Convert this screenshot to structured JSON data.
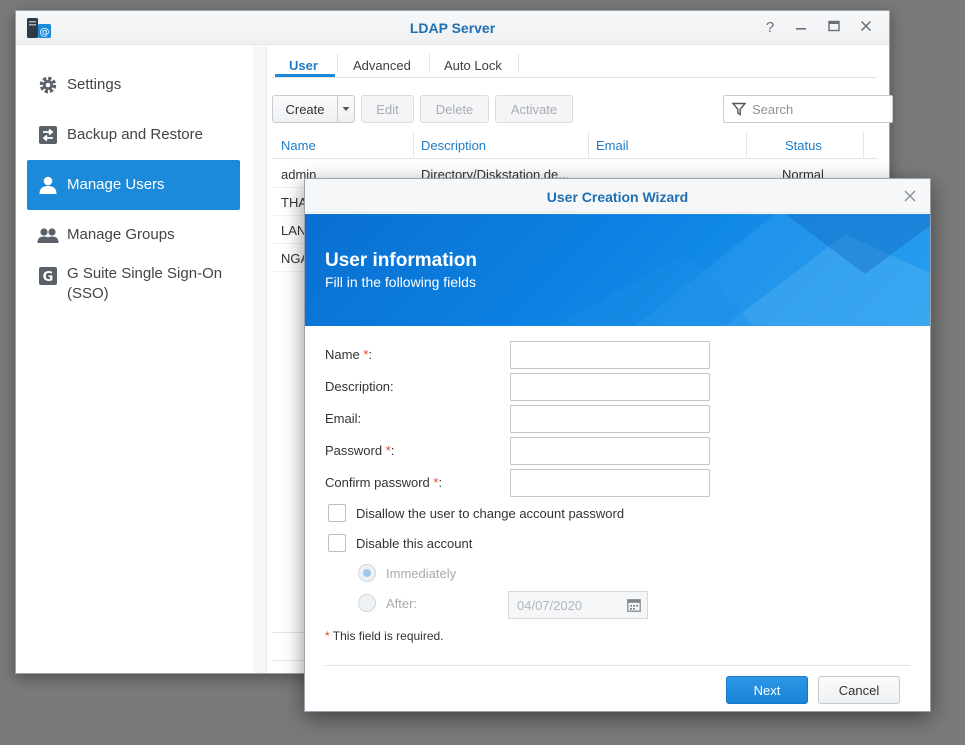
{
  "window": {
    "title": "LDAP Server"
  },
  "sidebar": {
    "items": [
      {
        "label": "Settings",
        "icon": "gear-icon"
      },
      {
        "label": "Backup and Restore",
        "icon": "backup-icon"
      },
      {
        "label": "Manage Users",
        "icon": "user-icon",
        "active": true
      },
      {
        "label": "Manage Groups",
        "icon": "group-icon"
      },
      {
        "label": "G Suite Single Sign-On (SSO)",
        "icon": "g-suite-icon"
      }
    ]
  },
  "tabs": [
    {
      "label": "User",
      "active": true
    },
    {
      "label": "Advanced"
    },
    {
      "label": "Auto Lock"
    }
  ],
  "toolbar": {
    "create": "Create",
    "edit": "Edit",
    "delete": "Delete",
    "activate": "Activate",
    "search_placeholder": "Search"
  },
  "table": {
    "columns": [
      "Name",
      "Description",
      "Email",
      "Status"
    ],
    "rows": [
      {
        "name": "admin",
        "description": "Directory/Diskstation de...",
        "email": "",
        "status": "Normal"
      },
      {
        "name": "THA",
        "description": "",
        "email": "",
        "status": ""
      },
      {
        "name": "LAN",
        "description": "",
        "email": "",
        "status": ""
      },
      {
        "name": "NGA",
        "description": "",
        "email": "",
        "status": ""
      }
    ]
  },
  "dialog": {
    "title": "User Creation Wizard",
    "banner_title": "User information",
    "banner_subtitle": "Fill in the following fields",
    "fields": {
      "name": "Name",
      "description": "Description:",
      "email": "Email:",
      "password": "Password",
      "confirm_password": "Confirm password"
    },
    "required_mark": "*",
    "colon": ":",
    "checkboxes": {
      "disallow_change": "Disallow the user to change account password",
      "disable_account": "Disable this account"
    },
    "radios": {
      "immediately": "Immediately",
      "after": "After:"
    },
    "date_value": "04/07/2020",
    "required_note": "This field is required.",
    "next": "Next",
    "cancel": "Cancel"
  },
  "colors": {
    "accent": "#1c8adb",
    "title_blue": "#1f6fb2",
    "required_red": "#e4472b"
  }
}
